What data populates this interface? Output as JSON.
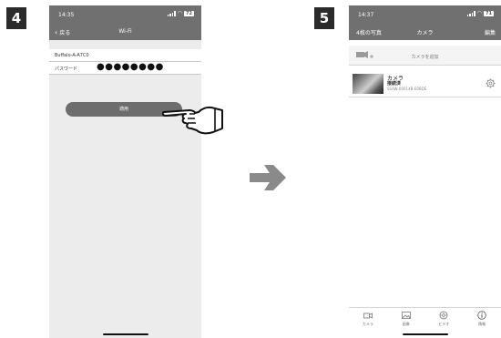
{
  "steps": {
    "left": "4",
    "right": "5"
  },
  "left_phone": {
    "status": {
      "time": "14:35",
      "battery": "72"
    },
    "nav": {
      "back_label": "戻る",
      "title": "Wi-Fi"
    },
    "form": {
      "ssid_value": "Buffalo-A-A7C0",
      "password_label": "パスワード",
      "password_mask": "●●●●●●●●"
    },
    "apply_button": "適用"
  },
  "right_phone": {
    "status": {
      "time": "14:37",
      "battery": "71"
    },
    "nav": {
      "left_label": "4枚の写真",
      "title": "カメラ",
      "right_label": "編集"
    },
    "add_camera": "カメラを追加",
    "camera": {
      "name": "カメラ",
      "state": "接続済",
      "id": "SSAW-00014B-E0BDE"
    },
    "tabs": [
      {
        "label": "カメラ",
        "icon": "camera-icon"
      },
      {
        "label": "画像",
        "icon": "image-icon"
      },
      {
        "label": "ビデオ",
        "icon": "video-icon"
      },
      {
        "label": "情報",
        "icon": "info-icon"
      }
    ]
  },
  "icons": {
    "pointer": "pointing-hand-icon",
    "arrow": "arrow-right-icon",
    "gear": "gear-icon"
  }
}
